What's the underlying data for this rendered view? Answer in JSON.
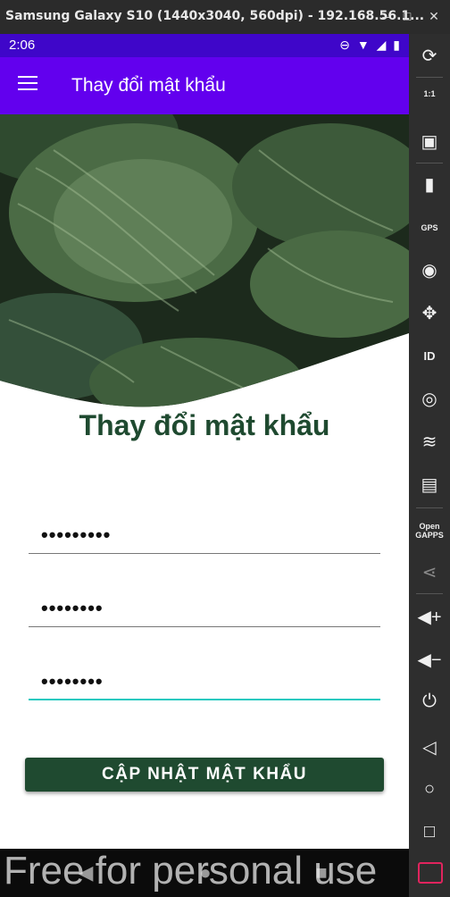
{
  "window": {
    "title": "Samsung Galaxy S10 (1440x3040, 560dpi) - 192.168.56.1...",
    "minimize": "–",
    "maximize": "□",
    "close": "✕"
  },
  "status": {
    "time": "2:06",
    "icons": "⊖ ▼ ◢ ▮"
  },
  "appbar": {
    "title": "Thay đổi mật khẩu"
  },
  "form": {
    "heading": "Thay đổi mật khẩu",
    "fields": [
      {
        "value": "•••••••••"
      },
      {
        "value": "••••••••"
      },
      {
        "value": "••••••••"
      }
    ],
    "submit_label": "CẬP NHẬT MẬT KHẨU"
  },
  "sidebar": {
    "gps": "GPS",
    "id": "ID",
    "opengapps": "Open GAPPS",
    "ratio": "1:1"
  },
  "navbar": {
    "back": "◀",
    "home": "●",
    "recent": "■"
  },
  "watermark": "Free for personal use",
  "colors": {
    "appbar": "#6200ee",
    "statusbar": "#3f06c9",
    "accent": "#1ec9c0",
    "button": "#1f4a30"
  }
}
